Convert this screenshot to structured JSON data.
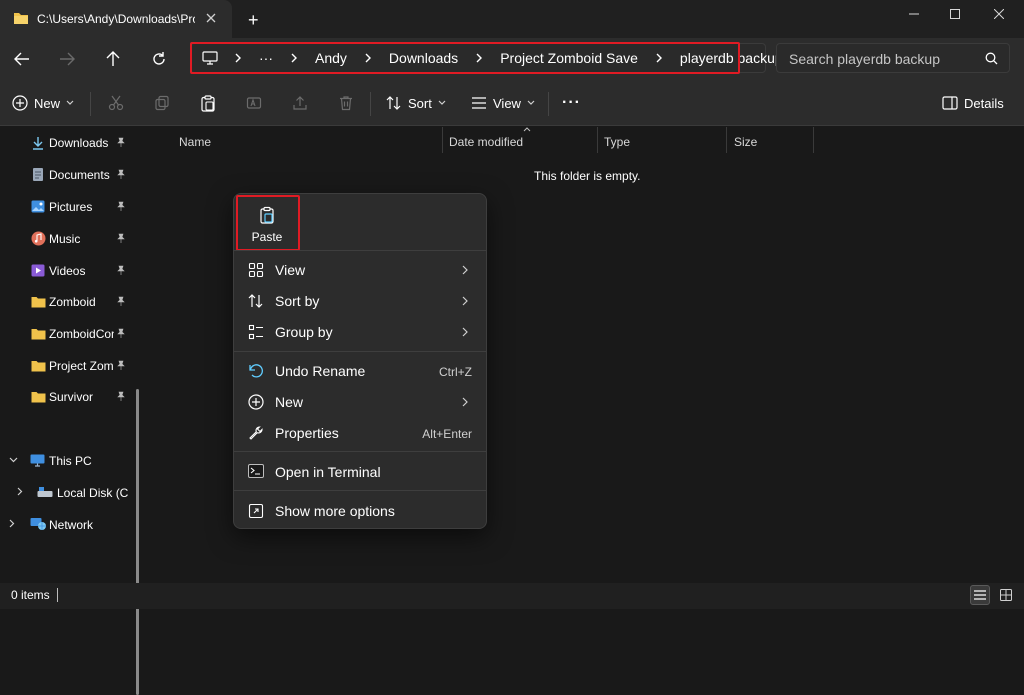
{
  "window": {
    "tab_title": "C:\\Users\\Andy\\Downloads\\Project Zomboid Save\\playerdb backup",
    "new_tab_label": "+",
    "icons": [
      "folder-icon",
      "minimize-icon",
      "maximize-icon",
      "close-icon"
    ]
  },
  "nav": {
    "breadcrumb": [
      "Andy",
      "Downloads",
      "Project Zomboid Save",
      "playerdb backup"
    ],
    "overflow_label": "···",
    "search_placeholder": "Search playerdb backup"
  },
  "commands": {
    "new_label": "New",
    "sort_label": "Sort",
    "view_label": "View",
    "more_label": "···",
    "details_label": "Details"
  },
  "sidebar": {
    "quick_access": [
      {
        "label": "Downloads",
        "icon": "download-icon",
        "color": "#7cc8f0"
      },
      {
        "label": "Documents",
        "icon": "document-icon",
        "color": "#9aa7b8"
      },
      {
        "label": "Pictures",
        "icon": "pictures-icon",
        "color": "#3f8fe0"
      },
      {
        "label": "Music",
        "icon": "music-icon",
        "color": "#e0705a"
      },
      {
        "label": "Videos",
        "icon": "videos-icon",
        "color": "#8a5bd6"
      },
      {
        "label": "Zomboid",
        "icon": "folder-icon",
        "color": "#f0c24b"
      },
      {
        "label": "ZomboidConfig",
        "icon": "folder-icon",
        "color": "#f0c24b"
      },
      {
        "label": "Project Zomboid Save",
        "icon": "folder-icon",
        "color": "#f0c24b"
      },
      {
        "label": "Survivor",
        "icon": "folder-icon",
        "color": "#f0c24b"
      }
    ],
    "this_pc": "This PC",
    "local_disk": "Local Disk (C:)",
    "network": "Network"
  },
  "content": {
    "columns": [
      "Name",
      "Date modified",
      "Type",
      "Size"
    ],
    "empty_message": "This folder is empty."
  },
  "context_menu": {
    "paste_label": "Paste",
    "items": [
      {
        "label": "View",
        "shortcut": "",
        "submenu": true,
        "icon": "grid-icon"
      },
      {
        "label": "Sort by",
        "shortcut": "",
        "submenu": true,
        "icon": "sort-icon"
      },
      {
        "label": "Group by",
        "shortcut": "",
        "submenu": true,
        "icon": "group-icon"
      },
      {
        "label": "Undo Rename",
        "shortcut": "Ctrl+Z",
        "submenu": false,
        "icon": "undo-icon"
      },
      {
        "label": "New",
        "shortcut": "",
        "submenu": true,
        "icon": "new-icon"
      },
      {
        "label": "Properties",
        "shortcut": "Alt+Enter",
        "submenu": false,
        "icon": "wrench-icon"
      },
      {
        "label": "Open in Terminal",
        "shortcut": "",
        "submenu": false,
        "icon": "terminal-icon"
      },
      {
        "label": "Show more options",
        "shortcut": "",
        "submenu": false,
        "icon": "more-options-icon"
      }
    ]
  },
  "status": {
    "items_count": "0 items"
  },
  "colors": {
    "highlight_box": "#e01b24",
    "accent": "#60cdff"
  }
}
